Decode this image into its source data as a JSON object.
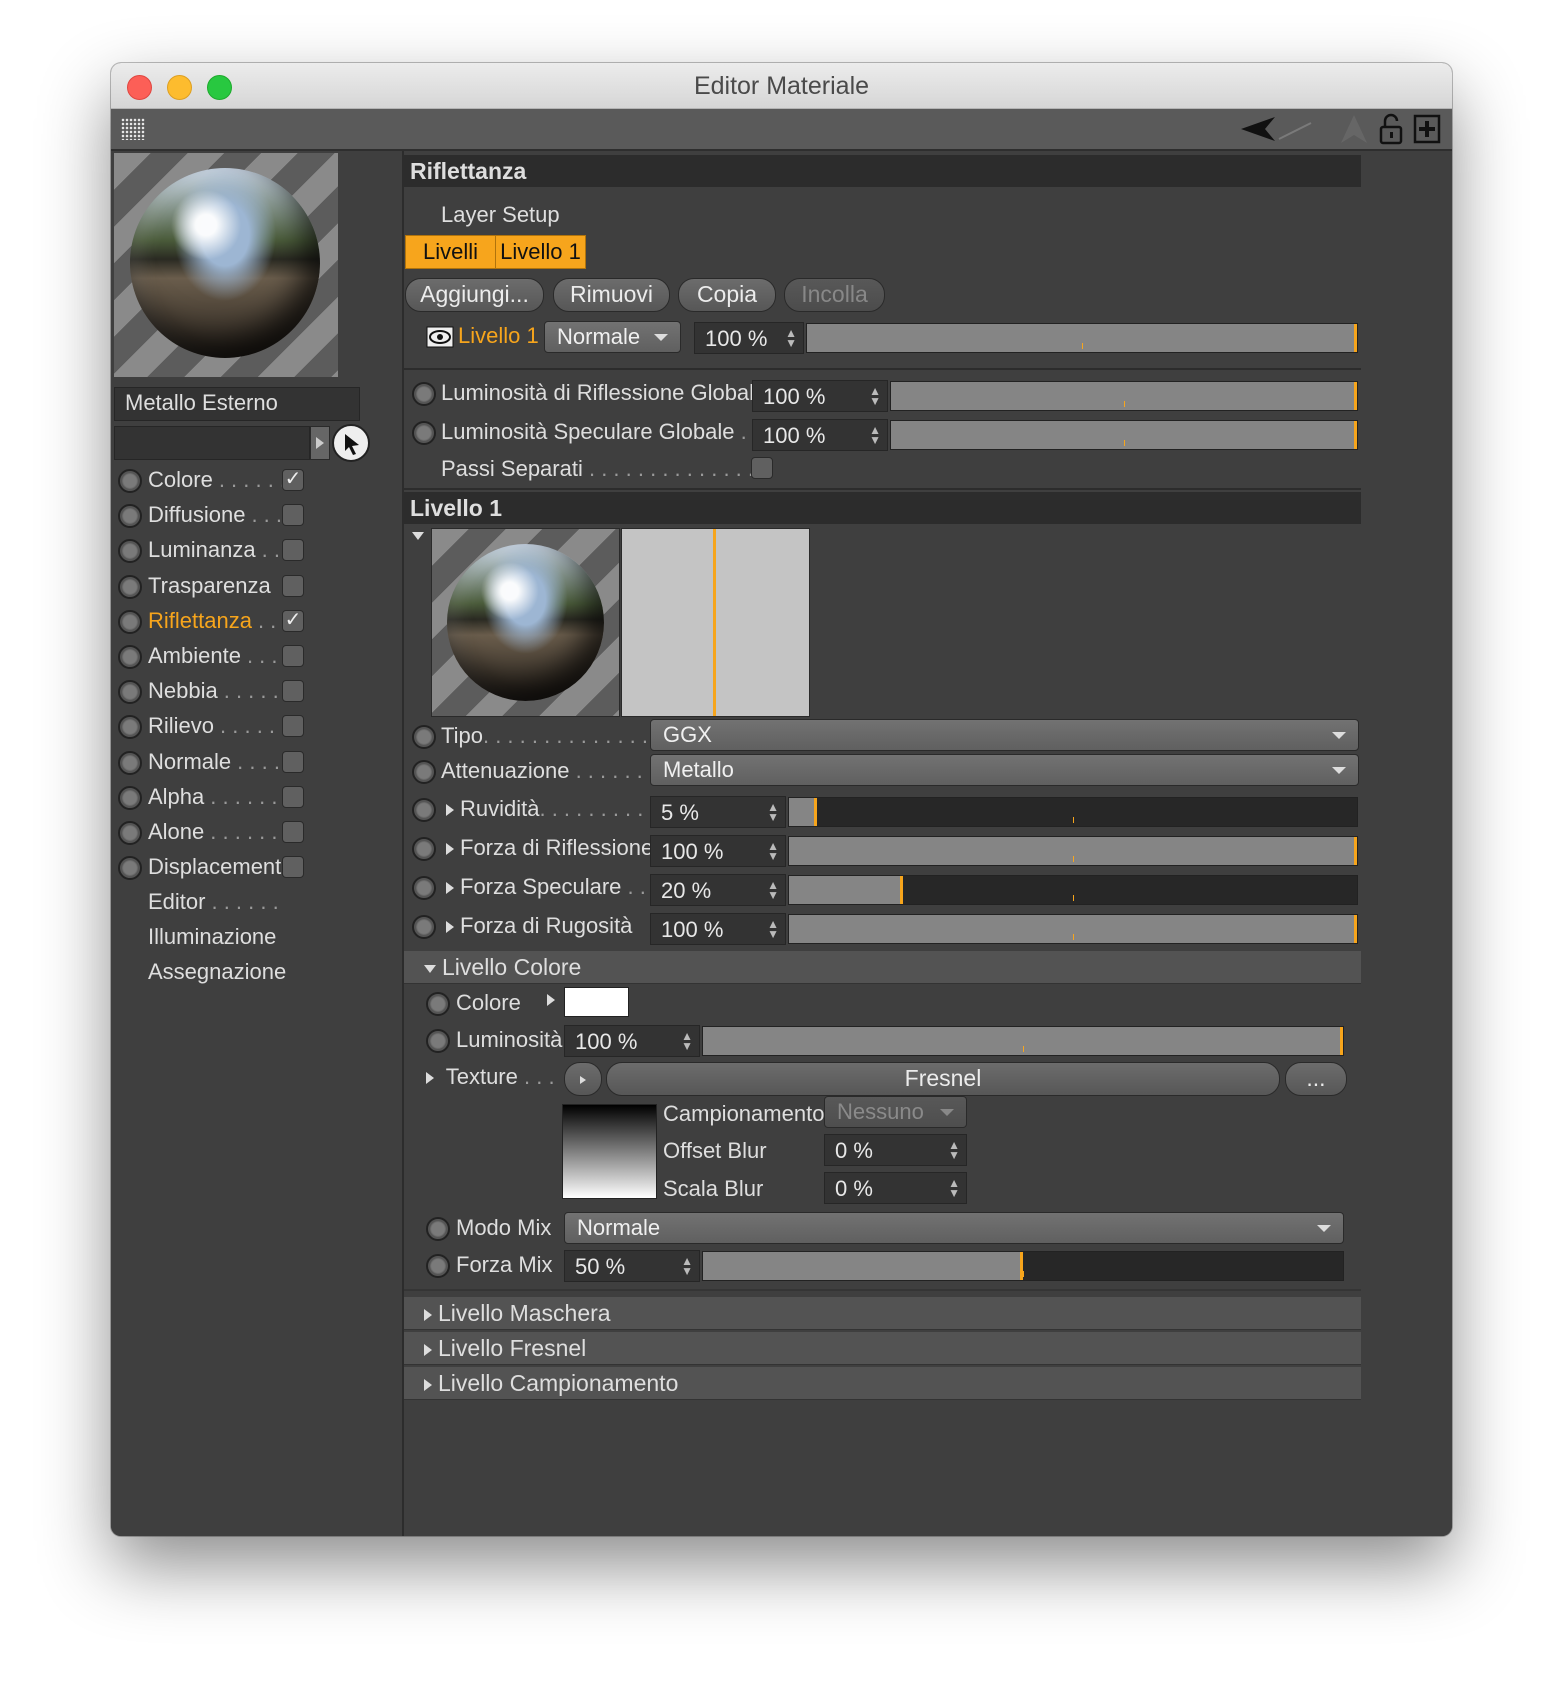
{
  "window": {
    "title": "Editor Materiale"
  },
  "sidebar": {
    "material_name": "Metallo Esterno",
    "channels": [
      {
        "label": "Colore",
        "dots": ". . . . . .",
        "checked": true,
        "active": false
      },
      {
        "label": "Diffusione",
        "dots": ". . .",
        "checked": false,
        "active": false
      },
      {
        "label": "Luminanza",
        "dots": ". .",
        "checked": false,
        "active": false
      },
      {
        "label": "Trasparenza",
        "dots": "",
        "checked": false,
        "active": false
      },
      {
        "label": "Riflettanza",
        "dots": ". .",
        "checked": true,
        "active": true
      },
      {
        "label": "Ambiente",
        "dots": ". . .",
        "checked": false,
        "active": false
      },
      {
        "label": "Nebbia",
        "dots": ". . . . .",
        "checked": false,
        "active": false
      },
      {
        "label": "Rilievo",
        "dots": ". . . . .",
        "checked": false,
        "active": false
      },
      {
        "label": "Normale",
        "dots": ". . . .",
        "checked": false,
        "active": false
      },
      {
        "label": "Alpha",
        "dots": ". . . . . .",
        "checked": false,
        "active": false
      },
      {
        "label": "Alone",
        "dots": ". . . . . .",
        "checked": false,
        "active": false
      },
      {
        "label": "Displacement",
        "dots": "",
        "checked": false,
        "active": false
      }
    ],
    "extra_items": [
      {
        "label": "Editor",
        "dots": ". . . . . ."
      },
      {
        "label": "Illuminazione",
        "dots": ""
      },
      {
        "label": "Assegnazione",
        "dots": ""
      }
    ]
  },
  "reflectance": {
    "header": "Riflettanza",
    "layer_setup_label": "Layer Setup",
    "tabs": [
      "Livelli",
      "Livello 1"
    ],
    "buttons": {
      "add": "Aggiungi...",
      "remove": "Rimuovi",
      "copy": "Copia",
      "paste": "Incolla"
    },
    "layer_row": {
      "name": "Livello 1",
      "blend": "Normale",
      "opacity": "100 %",
      "opacity_value": 1.0
    },
    "global_reflection": {
      "label": "Luminosità di Riflessione Globale",
      "value": "100 %",
      "fraction": 1.0
    },
    "global_specular": {
      "label": "Luminosità Speculare Globale",
      "dots": ". . .",
      "value": "100 %",
      "fraction": 1.0
    },
    "separate_passes": {
      "label": "Passi Separati",
      "dots": ". . . . . . . . . . . . . . .",
      "checked": false
    }
  },
  "layer1": {
    "header": "Livello 1",
    "type": {
      "label": "Tipo",
      "dots": ". . . . . . . . . . . . . . .",
      "value": "GGX"
    },
    "attenuation": {
      "label": "Attenuazione",
      "dots": ". . . . . . .",
      "value": "Metallo"
    },
    "roughness": {
      "label": "Ruvidità",
      "dots": ". . . . . . . . . .",
      "value": "5 %",
      "fraction": 0.05
    },
    "reflection_strength": {
      "label": "Forza di Riflessione",
      "value": "100 %",
      "fraction": 1.0
    },
    "specular_strength": {
      "label": "Forza Speculare",
      "dots": ". . .",
      "value": "20 %",
      "fraction": 0.2
    },
    "bump_strength": {
      "label": "Forza di Rugosità",
      "value": "100 %",
      "fraction": 1.0
    }
  },
  "color_layer": {
    "header": "Livello Colore",
    "color": {
      "label": "Colore",
      "swatch": "#ffffff"
    },
    "brightness": {
      "label": "Luminosità",
      "value": "100 %",
      "fraction": 1.0
    },
    "texture": {
      "label": "Texture",
      "dots": ". . .",
      "name": "Fresnel",
      "more": "..."
    },
    "sampling": {
      "label": "Campionamento",
      "value": "Nessuno"
    },
    "blur_offset": {
      "label": "Offset Blur",
      "value": "0 %"
    },
    "blur_scale": {
      "label": "Scala Blur",
      "value": "0 %"
    },
    "mix_mode": {
      "label": "Modo Mix",
      "value": "Normale"
    },
    "mix_strength": {
      "label": "Forza Mix",
      "value": "50 %",
      "fraction": 0.5
    }
  },
  "collapsed_sections": [
    "Livello Maschera",
    "Livello Fresnel",
    "Livello Campionamento"
  ],
  "colors": {
    "accent": "#f7a51c",
    "panel": "#3f3f3f",
    "header": "#2c2c2c"
  }
}
